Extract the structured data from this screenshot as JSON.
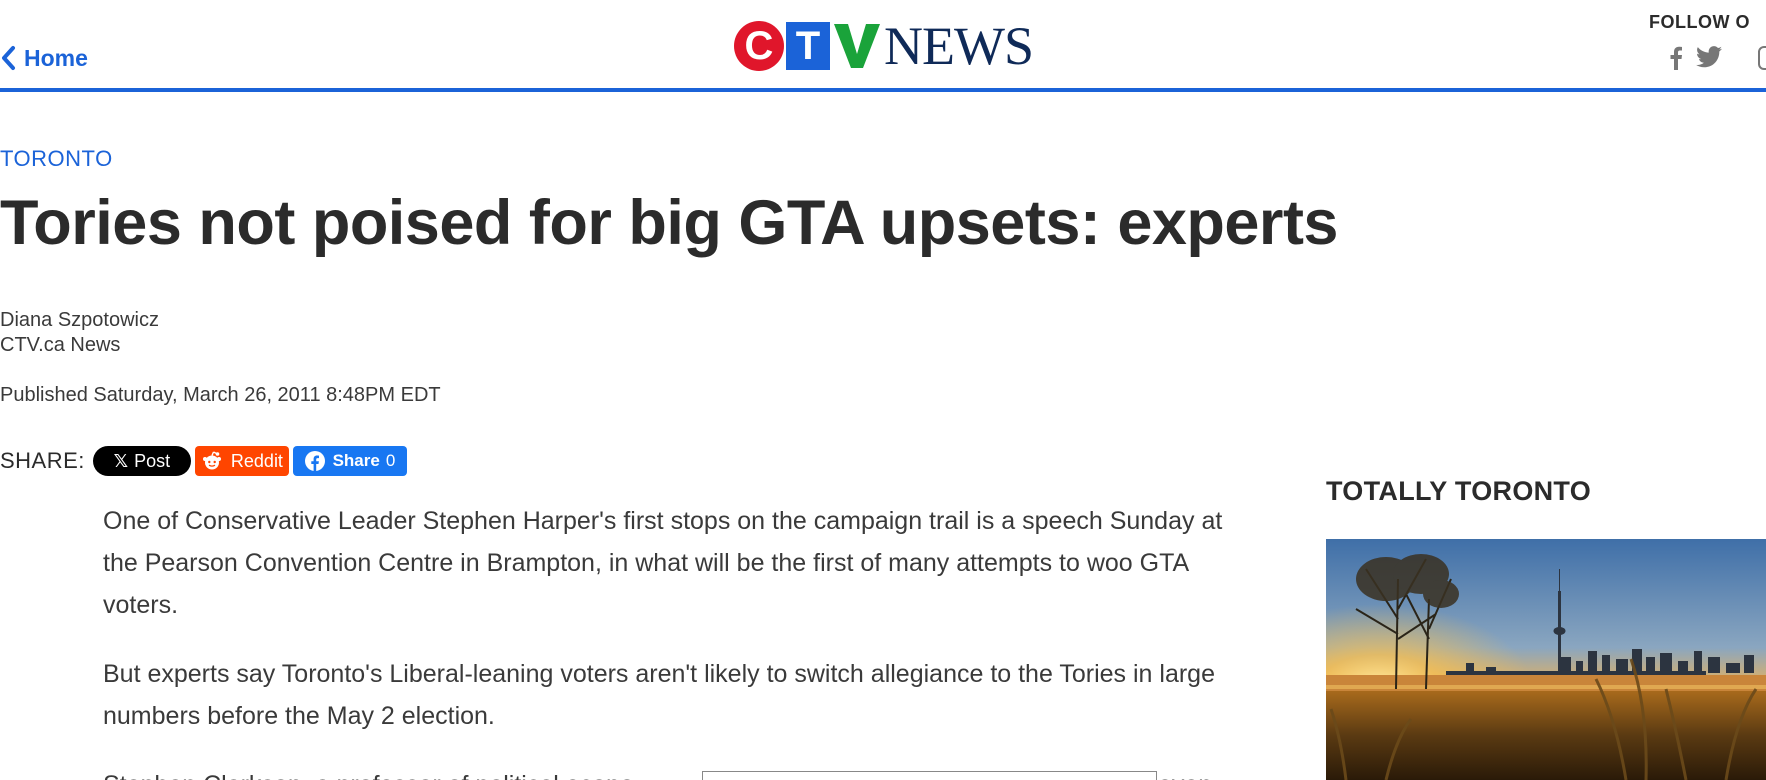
{
  "header": {
    "home_label": "Home",
    "logo": {
      "c": "C",
      "t": "T",
      "news": "NEWS"
    },
    "follow_label": "FOLLOW O",
    "social_icons": [
      "facebook-icon",
      "twitter-icon",
      "instagram-icon"
    ]
  },
  "article": {
    "section": "TORONTO",
    "headline": "Tories not poised for big GTA upsets: experts",
    "author_name": "Diana Szpotowicz",
    "author_outlet": "CTV.ca News",
    "published": "Published Saturday, March 26, 2011 8:48PM EDT",
    "paragraphs": [
      "One of Conservative Leader Stephen Harper's first stops on the campaign trail is a speech Sunday at the Pearson Convention Centre in Brampton, in what will be the first of many attempts to woo GTA voters.",
      "But experts say Toronto's Liberal-leaning voters aren't likely to switch allegiance to the Tories in large numbers before the May 2 election.",
      "Stephen Clarkson, a professor of political econo"
    ],
    "p3_tail": "even"
  },
  "share": {
    "label": "SHARE:",
    "x_label": "Post",
    "reddit_label": "Reddit",
    "facebook_label": "Share",
    "facebook_count": "0"
  },
  "sidebar": {
    "title": "TOTALLY TORONTO"
  },
  "colors": {
    "accent": "#1b63d8",
    "ctv_red": "#e0162b",
    "ctv_green": "#1aa33a",
    "news_navy": "#0f2a58",
    "reddit": "#ff4500",
    "facebook": "#1877f2"
  }
}
